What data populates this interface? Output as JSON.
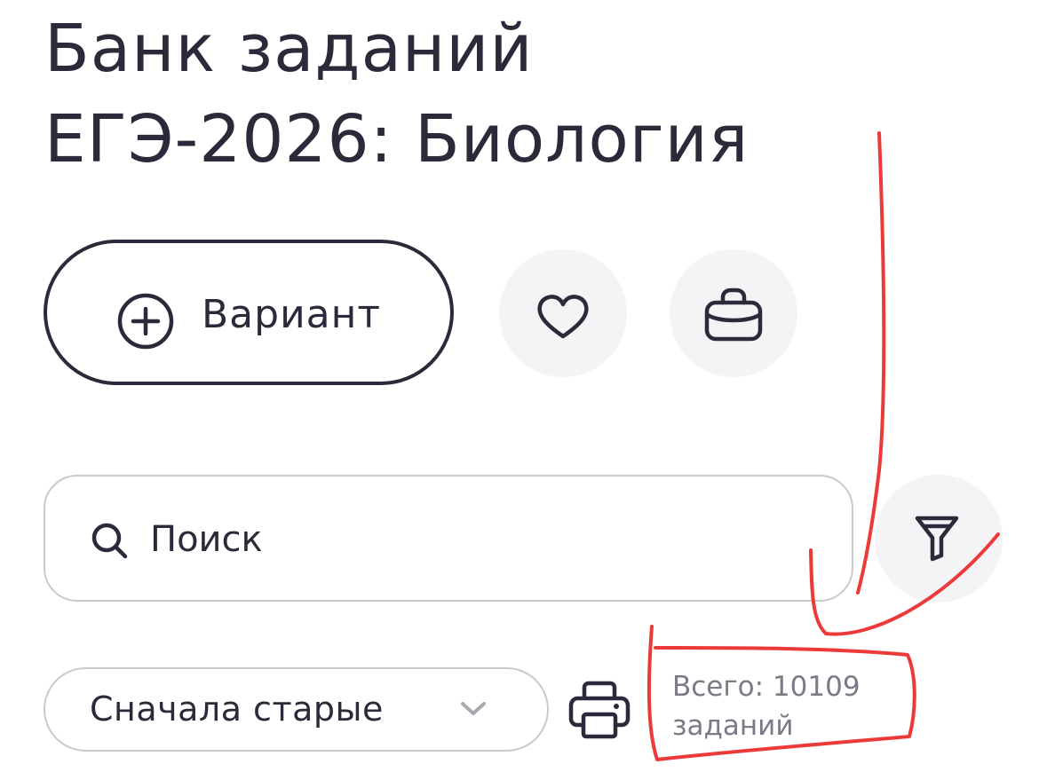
{
  "header": {
    "title_line1": "Банк заданий",
    "title_line2": "ЕГЭ-2026: Биология"
  },
  "actions": {
    "variant_label": "Вариант",
    "variant_icon": "plus-circle-icon",
    "favorites_icon": "heart-icon",
    "portfolio_icon": "briefcase-icon"
  },
  "search": {
    "placeholder": "Поиск",
    "value": "",
    "icon": "search-icon",
    "filter_icon": "filter-icon"
  },
  "sort": {
    "selected": "Сначала старые",
    "icon": "chevron-down-icon"
  },
  "print": {
    "icon": "printer-icon"
  },
  "total": {
    "text": "Всего: 10109 заданий"
  },
  "colors": {
    "text": "#2b2a3a",
    "muted": "#7b7a86",
    "border": "#c9c9d0",
    "round_bg": "#f4f4f7",
    "annotation": "#ec3a3a"
  }
}
